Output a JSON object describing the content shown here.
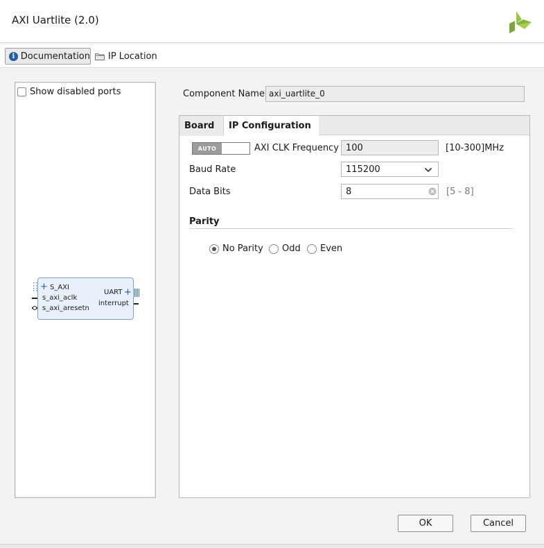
{
  "window": {
    "title": "AXI Uartlite (2.0)",
    "logo_icon": "xilinx-logo-icon"
  },
  "toolbar": {
    "documentation_label": "Documentation",
    "ip_location_label": "IP Location"
  },
  "left_panel": {
    "show_disabled_ports_label": "Show disabled ports",
    "show_disabled_ports_checked": false,
    "block": {
      "ports_left": [
        "S_AXI",
        "s_axi_aclk",
        "s_axi_aresetn"
      ],
      "ports_right": [
        "UART",
        "interrupt"
      ]
    }
  },
  "component": {
    "label": "Component Name",
    "value": "axi_uartlite_0"
  },
  "tabs": [
    {
      "label": "Board",
      "active": false
    },
    {
      "label": "IP Configuration",
      "active": true
    }
  ],
  "config": {
    "auto_label": "AUTO",
    "clk_label": "AXI CLK Frequency",
    "clk_value": "100",
    "clk_range": "[10-300]MHz",
    "baud_label": "Baud Rate",
    "baud_value": "115200",
    "data_bits_label": "Data Bits",
    "data_bits_value": "8",
    "data_bits_range": "[5 - 8]",
    "parity_title": "Parity",
    "parity_options": [
      {
        "label": "No Parity",
        "selected": true
      },
      {
        "label": "Odd",
        "selected": false
      },
      {
        "label": "Even",
        "selected": false
      }
    ]
  },
  "buttons": {
    "ok": "OK",
    "cancel": "Cancel"
  }
}
